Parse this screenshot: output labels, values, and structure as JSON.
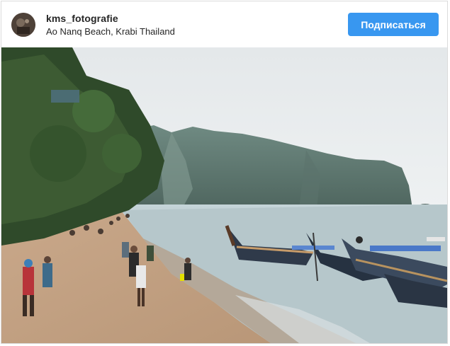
{
  "post": {
    "username": "kms_fotografie",
    "location": "Ao Nanq Beach, Krabi Thailand",
    "follow_label": "Подписаться"
  },
  "colors": {
    "follow_button": "#3897f0",
    "text": "#262626",
    "border": "#dbdbdb"
  },
  "photo": {
    "subject": "beach-with-longtail-boats-and-limestone-cliffs"
  }
}
